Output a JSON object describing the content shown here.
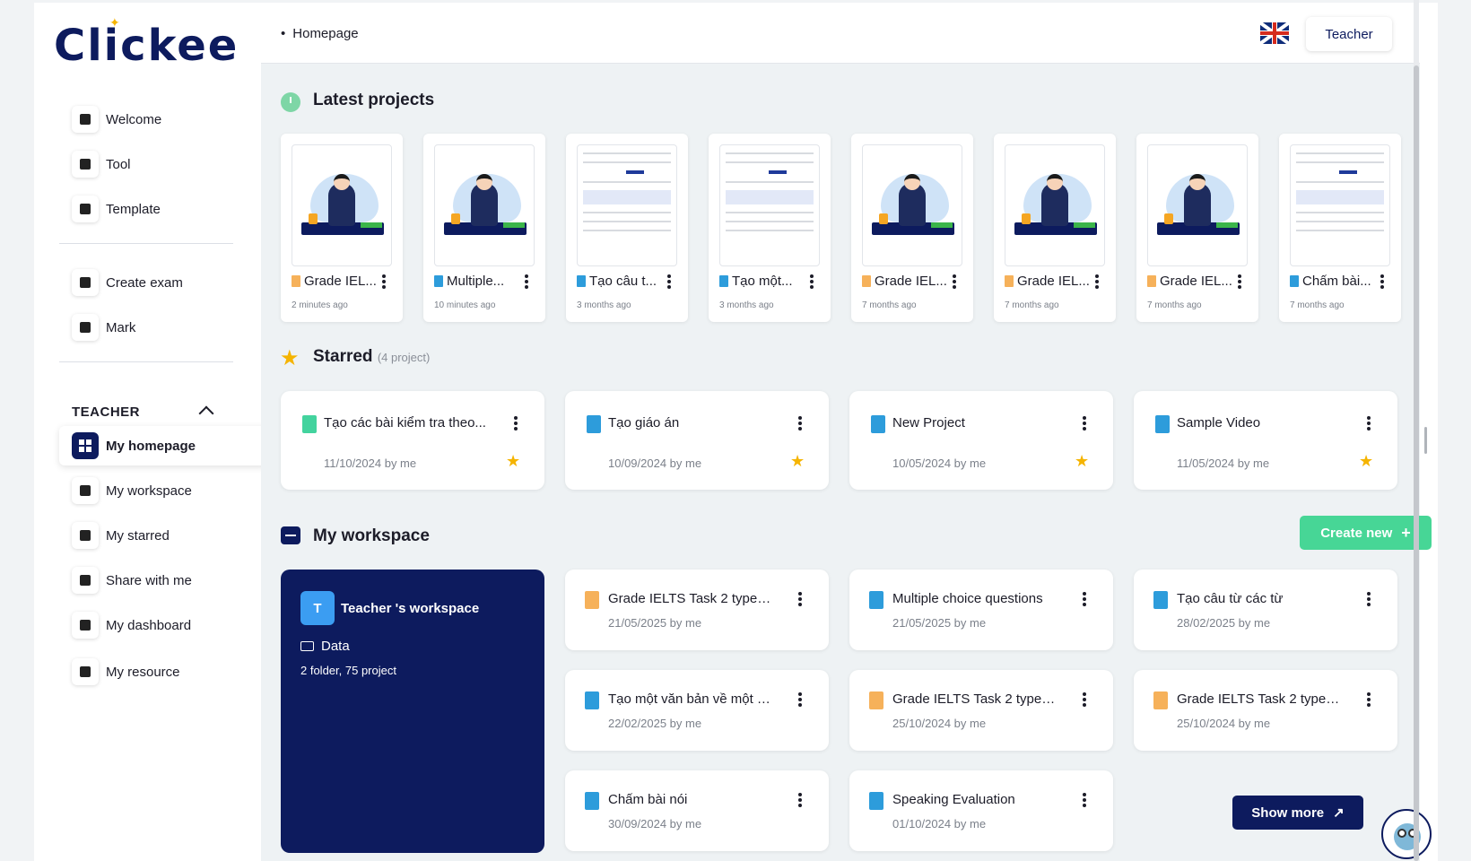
{
  "brand": {
    "logo_text": "Clickee"
  },
  "sidebar": {
    "group1": [
      {
        "label": "Welcome",
        "icon": "hand-icon"
      },
      {
        "label": "Tool",
        "icon": "tool-icon"
      },
      {
        "label": "Template",
        "icon": "template-icon"
      }
    ],
    "group2": [
      {
        "label": "Create exam",
        "icon": "exam-icon"
      },
      {
        "label": "Mark",
        "icon": "pen-icon"
      }
    ],
    "section_label": "TEACHER",
    "group3": [
      {
        "label": "My homepage",
        "icon": "grid-icon",
        "active": true
      },
      {
        "label": "My workspace",
        "icon": "folder-icon"
      },
      {
        "label": "My starred",
        "icon": "star-icon"
      },
      {
        "label": "Share with me",
        "icon": "share-icon"
      },
      {
        "label": "My dashboard",
        "icon": "chart-icon"
      },
      {
        "label": "My resource",
        "icon": "resource-icon"
      }
    ]
  },
  "topbar": {
    "breadcrumb": "Homepage",
    "language": "English (UK)",
    "role": "Teacher"
  },
  "latest": {
    "title": "Latest projects",
    "items": [
      {
        "title": "Grade IEL...",
        "time": "2 minutes ago",
        "color": "orange",
        "thumb": "illustration"
      },
      {
        "title": "Multiple...",
        "time": "10 minutes ago",
        "color": "blue",
        "thumb": "illustration"
      },
      {
        "title": "Tạo câu t...",
        "time": "3 months ago",
        "color": "blue",
        "thumb": "document"
      },
      {
        "title": "Tạo một...",
        "time": "3 months ago",
        "color": "blue",
        "thumb": "document"
      },
      {
        "title": "Grade IEL...",
        "time": "7 months ago",
        "color": "orange",
        "thumb": "illustration"
      },
      {
        "title": "Grade IEL...",
        "time": "7 months ago",
        "color": "orange",
        "thumb": "illustration"
      },
      {
        "title": "Grade IEL...",
        "time": "7 months ago",
        "color": "orange",
        "thumb": "illustration"
      },
      {
        "title": "Chấm bài...",
        "time": "7 months ago",
        "color": "blue",
        "thumb": "document"
      }
    ]
  },
  "starred": {
    "title": "Starred",
    "subtitle": "(4 project)",
    "items": [
      {
        "title": "Tạo các bài kiểm tra theo...",
        "date": "11/10/2024 by me",
        "color": "green"
      },
      {
        "title": "Tạo giáo án",
        "date": "10/09/2024 by me",
        "color": "blue"
      },
      {
        "title": "New Project",
        "date": "10/05/2024 by me",
        "color": "blue"
      },
      {
        "title": "Sample Video",
        "date": "11/05/2024 by me",
        "color": "blue"
      }
    ]
  },
  "workspace": {
    "title": "My workspace",
    "create_label": "Create new",
    "card": {
      "avatar": "T",
      "name": "Teacher 's workspace",
      "folder": "Data",
      "count": "2 folder, 75 project"
    },
    "items": [
      {
        "title": "Grade IELTS Task 2 typed...",
        "date": "21/05/2025 by me",
        "color": "orange"
      },
      {
        "title": "Multiple choice questions",
        "date": "21/05/2025 by me",
        "color": "blue"
      },
      {
        "title": "Tạo câu từ các từ",
        "date": "28/02/2025 by me",
        "color": "blue"
      },
      {
        "title": "Tạo một văn bản về một c...",
        "date": "22/02/2025 by me",
        "color": "blue"
      },
      {
        "title": "Grade IELTS Task 2 typed...",
        "date": "25/10/2024 by me",
        "color": "orange"
      },
      {
        "title": "Grade IELTS Task 2 typed...",
        "date": "25/10/2024 by me",
        "color": "orange"
      },
      {
        "title": "Chấm bài nói",
        "date": "30/09/2024 by me",
        "color": "blue"
      },
      {
        "title": "Speaking Evaluation",
        "date": "01/10/2024 by me",
        "color": "blue"
      }
    ],
    "show_more_label": "Show more"
  },
  "colors": {
    "brand_navy": "#0d1b5e",
    "accent_green": "#47d696",
    "star": "#f5b400"
  }
}
